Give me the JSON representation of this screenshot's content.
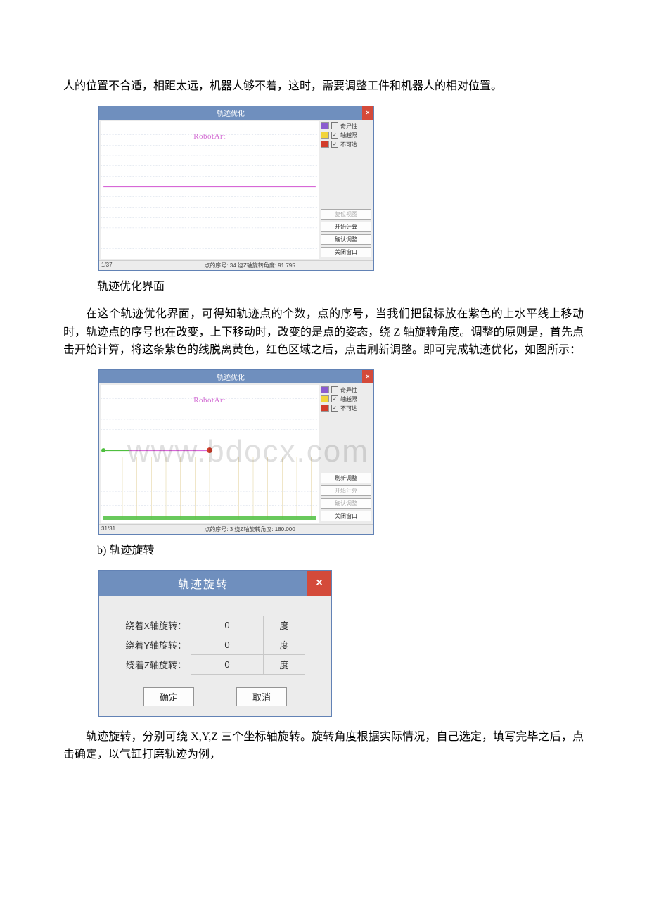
{
  "p1": "人的位置不合适，相距太远，机器人够不着，这时，需要调整工件和机器人的相对位置。",
  "cap1": "轨迹优化界面",
  "p2": "在这个轨迹优化界面，可得知轨迹点的个数，点的序号，当我们把鼠标放在紫色的上水平线上移动时，轨迹点的序号也在改变，上下移动时，改变的是点的姿态，绕 Z 轴旋转角度。调整的原则是，首先点击开始计算，将这条紫色的线脱离黄色，红色区域之后，点击刷新调整。即可完成轨迹优化，如图所示：",
  "cap2": "b) 轨迹旋转",
  "p3": "轨迹旋转，分别可绕 X,Y,Z 三个坐标轴旋转。旋转角度根据实际情况，自己选定，填写完毕之后，点击确定，以气缸打磨轨迹为例，",
  "fig1": {
    "title": "轨迹优化",
    "close": "×",
    "brand": "RobotArt",
    "legend": {
      "singular": {
        "color": "#8b5bcf",
        "checked": false,
        "label": "奇异性"
      },
      "overlimit": {
        "color": "#f2d43a",
        "checked": true,
        "label": "轴越限"
      },
      "unreach": {
        "color": "#d23c2a",
        "checked": true,
        "label": "不可达"
      }
    },
    "buttons": {
      "reset_view": "复位视图",
      "start_calc": "开始计算",
      "confirm_adjust": "确认调整",
      "close_win": "关闭窗口"
    },
    "status": {
      "seq": "1/37",
      "info": "点的序号: 34 绕Z轴旋转角度: 91.795"
    },
    "chart_data": {
      "type": "line",
      "x": [
        0,
        37
      ],
      "ylim": [
        -180,
        180
      ],
      "series": [
        {
          "name": "magenta-line",
          "points": [
            [
              0,
              0
            ],
            [
              37,
              0
            ]
          ]
        }
      ]
    }
  },
  "fig2": {
    "title": "轨迹优化",
    "close": "×",
    "brand": "RobotArt",
    "legend": {
      "singular": {
        "color": "#8b5bcf",
        "checked": false,
        "label": "奇异性"
      },
      "overlimit": {
        "color": "#f2d43a",
        "checked": true,
        "label": "轴越限"
      },
      "unreach": {
        "color": "#d23c2a",
        "checked": true,
        "label": "不可达"
      }
    },
    "buttons": {
      "refresh_adjust": "刷新调整",
      "start_calc": "开始计算",
      "confirm_adjust": "确认调整",
      "close_win": "关闭窗口"
    },
    "status": {
      "seq": "31/31",
      "info": "点的序号: 3 绕Z轴旋转角度: 180.000"
    },
    "watermark": "www.bdocx.com",
    "chart_data": {
      "type": "line",
      "x": [
        0,
        31
      ],
      "ylim": [
        -180,
        180
      ],
      "series": [
        {
          "name": "green-seg",
          "points": [
            [
              0,
              0
            ],
            [
              3,
              0
            ]
          ]
        },
        {
          "name": "magenta-seg",
          "points": [
            [
              3,
              0
            ],
            [
              14,
              0
            ]
          ]
        },
        {
          "name": "red-point",
          "points": [
            [
              14,
              0
            ]
          ]
        }
      ]
    }
  },
  "rot": {
    "title": "轨迹旋转",
    "close": "×",
    "rows": [
      {
        "label": "绕着X轴旋转：",
        "value": "0",
        "unit": "度"
      },
      {
        "label": "绕着Y轴旋转：",
        "value": "0",
        "unit": "度"
      },
      {
        "label": "绕着Z轴旋转：",
        "value": "0",
        "unit": "度"
      }
    ],
    "ok": "确定",
    "cancel": "取消"
  }
}
